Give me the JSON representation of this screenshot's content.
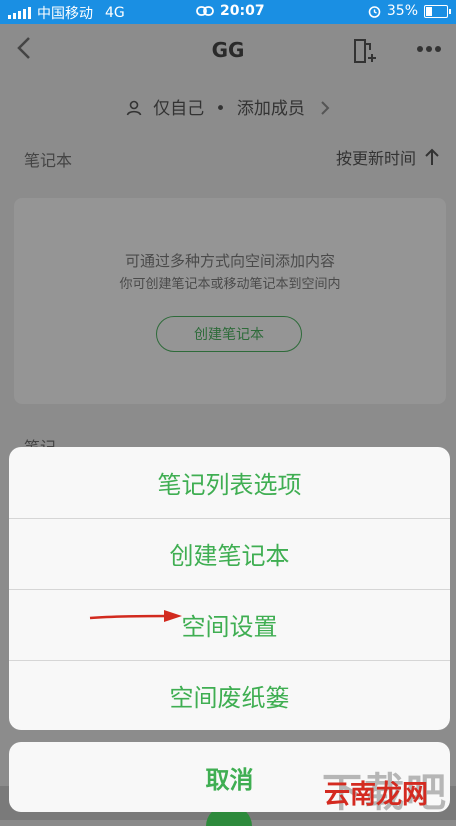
{
  "status_bar": {
    "carrier": "中国移动",
    "network": "4G",
    "time": "20:07",
    "battery_percent": "35%",
    "battery_level": 0.35
  },
  "nav": {
    "title": "GG",
    "back_icon": "chevron-left-icon",
    "doc_icon": "add-document-icon",
    "more_icon": "more-dots-icon"
  },
  "members": {
    "visibility": "仅自己",
    "separator": "•",
    "add_label": "添加成员"
  },
  "notebooks": {
    "header": "笔记本",
    "sort_label": "按更新时间"
  },
  "empty_state": {
    "line1": "可通过多种方式向空间添加内容",
    "line2": "你可创建笔记本或移动笔记本到空间内",
    "create_button": "创建笔记本"
  },
  "notes_header": "笔记",
  "action_sheet": {
    "items": [
      {
        "label": "笔记列表选项"
      },
      {
        "label": "创建笔记本"
      },
      {
        "label": "空间设置"
      },
      {
        "label": "空间废纸篓"
      }
    ],
    "cancel_label": "取消"
  },
  "colors": {
    "status_bar": "#1a8fe3",
    "accent_green": "#3fae52",
    "annotation_arrow": "#d22a1e"
  },
  "watermark": {
    "text": "云南龙网"
  }
}
